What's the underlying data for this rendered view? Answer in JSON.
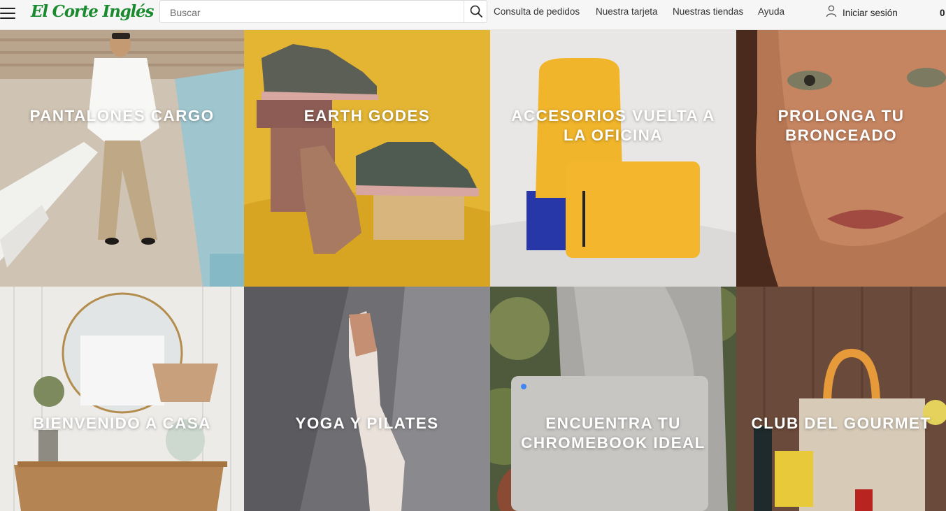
{
  "header": {
    "logo_text": "El Corte Inglés",
    "search": {
      "placeholder": "Buscar"
    },
    "nav": [
      "Consulta de pedidos",
      "Nuestra tarjeta",
      "Nuestras tiendas",
      "Ayuda"
    ],
    "login_label": "Iniciar sesión",
    "cart_count": "0"
  },
  "icons": {
    "menu": "hamburger-menu-icon",
    "search": "magnifier-search-icon",
    "user": "user-icon"
  },
  "colors": {
    "brand_green": "#1a8a2f",
    "header_bg": "#f6f6f6",
    "tile_text": "#ffffff"
  },
  "tiles": [
    {
      "title": "PANTALONES CARGO"
    },
    {
      "title": "EARTH GODES"
    },
    {
      "title": "ACCESORIOS VUELTA A LA OFICINA"
    },
    {
      "title": "PROLONGA TU BRONCEADO"
    },
    {
      "title": "BIENVENIDO A CASA"
    },
    {
      "title": "YOGA Y PILATES"
    },
    {
      "title": "ENCUENTRA TU CHROMEBOOK IDEAL"
    },
    {
      "title": "CLUB DEL GOURMET"
    }
  ]
}
